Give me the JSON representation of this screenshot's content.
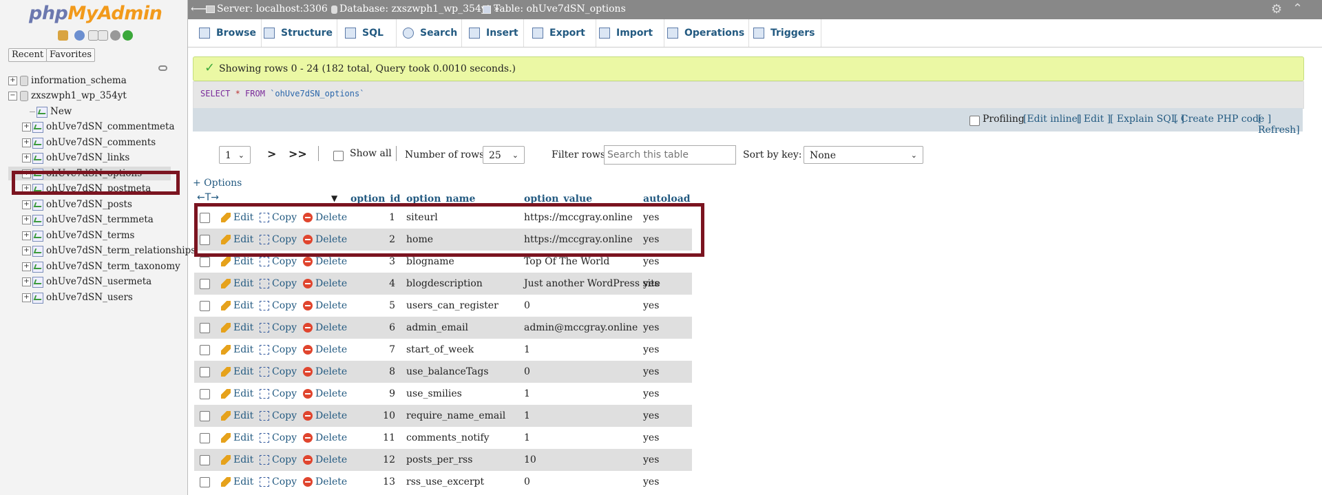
{
  "logo": {
    "php": "php",
    "my": "MyAdmin"
  },
  "sidebar": {
    "tabs": [
      "Recent",
      "Favorites"
    ],
    "tree": [
      {
        "label": "information_schema",
        "type": "db",
        "expander": "+"
      },
      {
        "label": "zxszwph1_wp_354yt",
        "type": "db",
        "expander": "−"
      },
      {
        "label": "New",
        "type": "new"
      },
      {
        "label": "ohUve7dSN_commentmeta",
        "type": "table"
      },
      {
        "label": "ohUve7dSN_comments",
        "type": "table"
      },
      {
        "label": "ohUve7dSN_links",
        "type": "table"
      },
      {
        "label": "ohUve7dSN_options",
        "type": "table",
        "selected": true
      },
      {
        "label": "ohUve7dSN_postmeta",
        "type": "table"
      },
      {
        "label": "ohUve7dSN_posts",
        "type": "table"
      },
      {
        "label": "ohUve7dSN_termmeta",
        "type": "table"
      },
      {
        "label": "ohUve7dSN_terms",
        "type": "table"
      },
      {
        "label": "ohUve7dSN_term_relationships",
        "type": "table"
      },
      {
        "label": "ohUve7dSN_term_taxonomy",
        "type": "table"
      },
      {
        "label": "ohUve7dSN_usermeta",
        "type": "table"
      },
      {
        "label": "ohUve7dSN_users",
        "type": "table"
      }
    ]
  },
  "breadcrumb": {
    "server": "Server: localhost:3306 »",
    "database": "Database: zxszwph1_wp_354yt »",
    "table": "Table: ohUve7dSN_options"
  },
  "tabs": [
    "Browse",
    "Structure",
    "SQL",
    "Search",
    "Insert",
    "Export",
    "Import",
    "Operations",
    "Triggers"
  ],
  "message": "Showing rows 0 - 24 (182 total, Query took 0.0010 seconds.)",
  "sql": {
    "select": "SELECT",
    "star": " * ",
    "from": "FROM",
    "table": "`ohUve7dSN_options`"
  },
  "profiling": {
    "label": "Profiling",
    "links": [
      "[Edit inline]",
      "[ Edit ]",
      "[ Explain SQL ]",
      "[ Create PHP code ]",
      "[ Refresh]"
    ]
  },
  "nav": {
    "page": "1",
    "next": ">",
    "last": ">>",
    "show_all": "Show all",
    "rows_label": "Number of rows:",
    "rows_value": "25",
    "filter_label": "Filter rows:",
    "filter_placeholder": "Search this table",
    "sort_label": "Sort by key:",
    "sort_value": "None"
  },
  "options_link": "+ Options",
  "columns": [
    "option_id",
    "option_name",
    "option_value",
    "autoload"
  ],
  "actions": {
    "edit": "Edit",
    "copy": "Copy",
    "delete": "Delete"
  },
  "rows": [
    {
      "id": "1",
      "name": "siteurl",
      "value": "https://mccgray.online",
      "autoload": "yes"
    },
    {
      "id": "2",
      "name": "home",
      "value": "https://mccgray.online",
      "autoload": "yes"
    },
    {
      "id": "3",
      "name": "blogname",
      "value": "Top Of The World",
      "autoload": "yes"
    },
    {
      "id": "4",
      "name": "blogdescription",
      "value": "Just another WordPress site",
      "autoload": "yes"
    },
    {
      "id": "5",
      "name": "users_can_register",
      "value": "0",
      "autoload": "yes"
    },
    {
      "id": "6",
      "name": "admin_email",
      "value": "admin@mccgray.online",
      "autoload": "yes"
    },
    {
      "id": "7",
      "name": "start_of_week",
      "value": "1",
      "autoload": "yes"
    },
    {
      "id": "8",
      "name": "use_balanceTags",
      "value": "0",
      "autoload": "yes"
    },
    {
      "id": "9",
      "name": "use_smilies",
      "value": "1",
      "autoload": "yes"
    },
    {
      "id": "10",
      "name": "require_name_email",
      "value": "1",
      "autoload": "yes"
    },
    {
      "id": "11",
      "name": "comments_notify",
      "value": "1",
      "autoload": "yes"
    },
    {
      "id": "12",
      "name": "posts_per_rss",
      "value": "10",
      "autoload": "yes"
    },
    {
      "id": "13",
      "name": "rss_use_excerpt",
      "value": "0",
      "autoload": "yes"
    }
  ],
  "colors": {
    "link": "#235a81",
    "highlight": "#7b1420",
    "success_bg": "#ebf8a4"
  }
}
